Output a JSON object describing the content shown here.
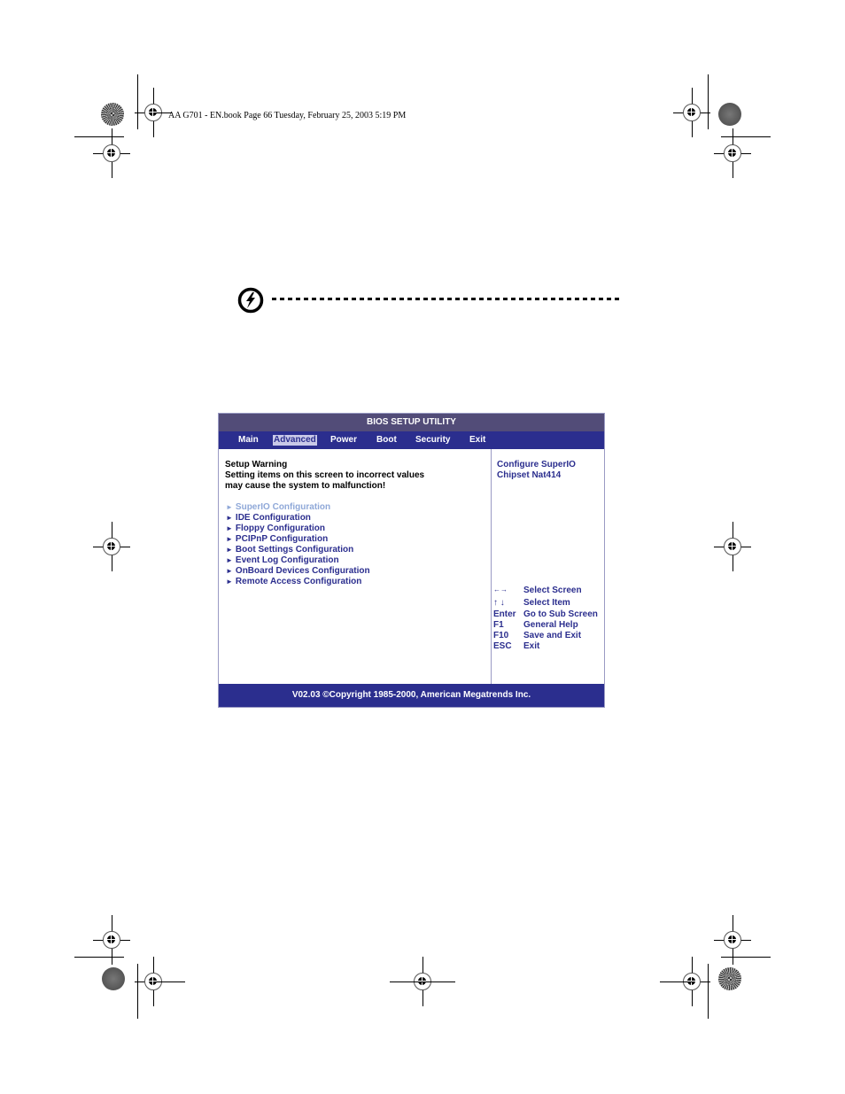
{
  "page_header": {
    "text": "AA G701 - EN.book  Page 66  Tuesday, February 25, 2003  5:19 PM"
  },
  "warning_icon": "lightning-warning-icon",
  "bios": {
    "title": "BIOS SETUP UTILITY",
    "tabs": [
      {
        "label": "Main",
        "active": false
      },
      {
        "label": "Advanced",
        "active": true
      },
      {
        "label": "Power",
        "active": false
      },
      {
        "label": "Boot",
        "active": false
      },
      {
        "label": "Security",
        "active": false
      },
      {
        "label": "Exit",
        "active": false
      }
    ],
    "warning": {
      "title": "Setup Warning",
      "lines": [
        "Setting items on this screen to incorrect values",
        "may cause the system to malfunction!"
      ]
    },
    "menu_items": [
      {
        "label": "SuperIO Configuration",
        "selected": true
      },
      {
        "label": "IDE Configuration",
        "selected": false
      },
      {
        "label": "Floppy Configuration",
        "selected": false
      },
      {
        "label": "PCIPnP Configuration",
        "selected": false
      },
      {
        "label": "Boot Settings Configuration",
        "selected": false
      },
      {
        "label": "Event Log Configuration",
        "selected": false
      },
      {
        "label": "OnBoard Devices Configuration",
        "selected": false
      },
      {
        "label": "Remote Access Configuration",
        "selected": false
      }
    ],
    "item_arrow": "►",
    "help_text": [
      "Configure SuperIO",
      "Chipset Nat414"
    ],
    "keys": [
      {
        "key": "←→",
        "desc": "Select Screen"
      },
      {
        "key": "↑ ↓",
        "desc": "Select Item"
      },
      {
        "key": "Enter",
        "desc": "Go to Sub Screen"
      },
      {
        "key": "F1",
        "desc": "General Help"
      },
      {
        "key": "F10",
        "desc": "Save and Exit"
      },
      {
        "key": "ESC",
        "desc": "Exit"
      }
    ],
    "footer": "V02.03 ©Copyright 1985-2000, American Megatrends Inc.",
    "colors": {
      "title_bar": "#524c78",
      "menu_bar": "#2b2e8e",
      "text_blue": "#2b2e8e",
      "selected_item": "#8fa8d8",
      "active_tab_bg": "#c9c9e8"
    }
  }
}
